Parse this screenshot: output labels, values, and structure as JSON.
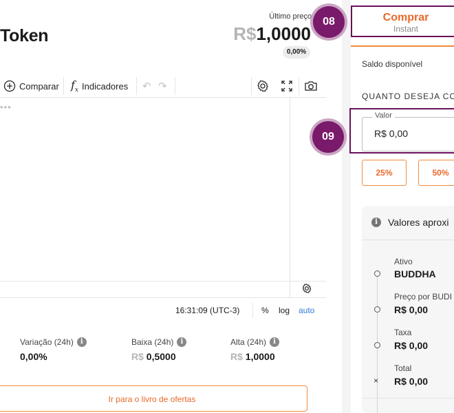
{
  "header": {
    "token_title": "Token",
    "last_price_label": "Último preço",
    "price_currency": "R$",
    "price_value": "1,0000",
    "price_change_badge": "0,00%"
  },
  "toolbar": {
    "compare_label": "Comparar",
    "indicators_label": "Indicadores",
    "icons": [
      "plus-circle-icon",
      "function-icon",
      "undo-icon",
      "redo-icon",
      "gear-icon",
      "fullscreen-icon",
      "camera-icon"
    ]
  },
  "chart": {
    "time": "16:31:09 (UTC-3)",
    "percent_label": "%",
    "log_label": "log",
    "auto_label": "auto"
  },
  "stats": [
    {
      "label": "Variação (24h)",
      "currency": "",
      "value": "0,00%"
    },
    {
      "label": "Baixa (24h)",
      "currency": "R$",
      "value": "0,5000"
    },
    {
      "label": "Alta (24h)",
      "currency": "R$",
      "value": "1,0000"
    }
  ],
  "order_book_button": "Ir para o livro de ofertas",
  "trade_panel": {
    "buy_tab_title": "Comprar",
    "buy_tab_subtitle": "Instant",
    "balance_label": "Saldo disponível",
    "amount_question": "QUANTO DESEJA CO",
    "amount_legend": "Valor",
    "amount_value": "R$ 0,00",
    "percent_buttons": [
      "25%",
      "50%"
    ],
    "approx_title": "Valores aproxi",
    "approx_items": [
      {
        "label": "Ativo",
        "value": "BUDDHA"
      },
      {
        "label": "Preço por BUDI",
        "value": "R$ 0,00"
      },
      {
        "label": "Taxa",
        "value": "R$ 0,00"
      },
      {
        "label": "Total",
        "value": "R$ 0,00"
      }
    ]
  },
  "step_badges": {
    "buy_tab": "08",
    "amount_field": "09"
  },
  "colors": {
    "accent_orange": "#e8692a",
    "highlight_purple": "#6b0f5a",
    "muted_currency": "#b5b5b5"
  }
}
